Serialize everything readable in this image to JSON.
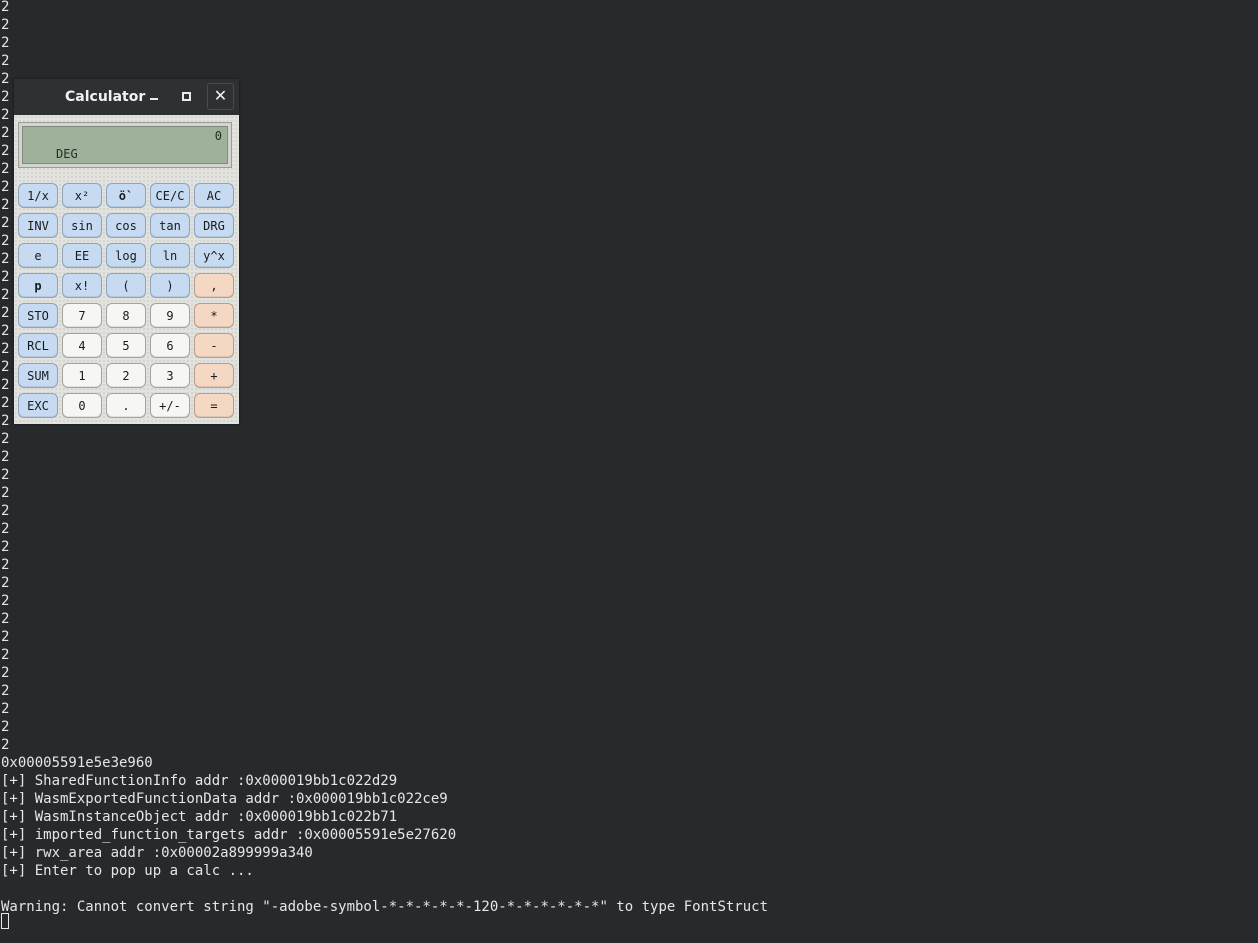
{
  "terminal": {
    "output_lines": [
      "2",
      "2",
      "2",
      "2",
      "2",
      "2",
      "2",
      "2",
      "2",
      "2",
      "2",
      "2",
      "2",
      "2",
      "2",
      "2",
      "2",
      "2",
      "2",
      "2",
      "2",
      "2",
      "2",
      "2",
      "2",
      "2",
      "2",
      "2",
      "2",
      "2",
      "2",
      "2",
      "2",
      "2",
      "2",
      "2",
      "2",
      "2",
      "2",
      "2",
      "2",
      "2"
    ],
    "log_lines": [
      "0x00005591e5e3e960",
      "[+] SharedFunctionInfo addr :0x000019bb1c022d29",
      "[+] WasmExportedFunctionData addr :0x000019bb1c022ce9",
      "[+] WasmInstanceObject addr :0x000019bb1c022b71",
      "[+] imported_function_targets addr :0x00005591e5e27620",
      "[+] rwx_area addr :0x00002a899999a340",
      "[+] Enter to pop up a calc ...",
      "",
      "Warning: Cannot convert string \"-adobe-symbol-*-*-*-*-*-120-*-*-*-*-*-*\" to type FontStruct"
    ]
  },
  "calculator": {
    "title": "Calculator",
    "minimize_icon": "minimize-icon",
    "maximize_icon": "maximize-icon",
    "close_label": "✕",
    "display_value": "0",
    "display_mode": "DEG",
    "colors": {
      "function_key": "#c6dbf2",
      "number_key": "#f6f6f4",
      "operator_key": "#f4d8c3",
      "lcd": "#9fb09b"
    },
    "keys": [
      [
        "1/x",
        "x²",
        "ö`",
        "CE/C",
        "AC"
      ],
      [
        "INV",
        "sin",
        "cos",
        "tan",
        "DRG"
      ],
      [
        "e",
        "EE",
        "log",
        "ln",
        "y^x"
      ],
      [
        "p",
        "x!",
        "(",
        ")",
        ","
      ],
      [
        "STO",
        "7",
        "8",
        "9",
        "*"
      ],
      [
        "RCL",
        "4",
        "5",
        "6",
        "-"
      ],
      [
        "SUM",
        "1",
        "2",
        "3",
        "+"
      ],
      [
        "EXC",
        "0",
        ".",
        "+/-",
        "="
      ]
    ]
  }
}
